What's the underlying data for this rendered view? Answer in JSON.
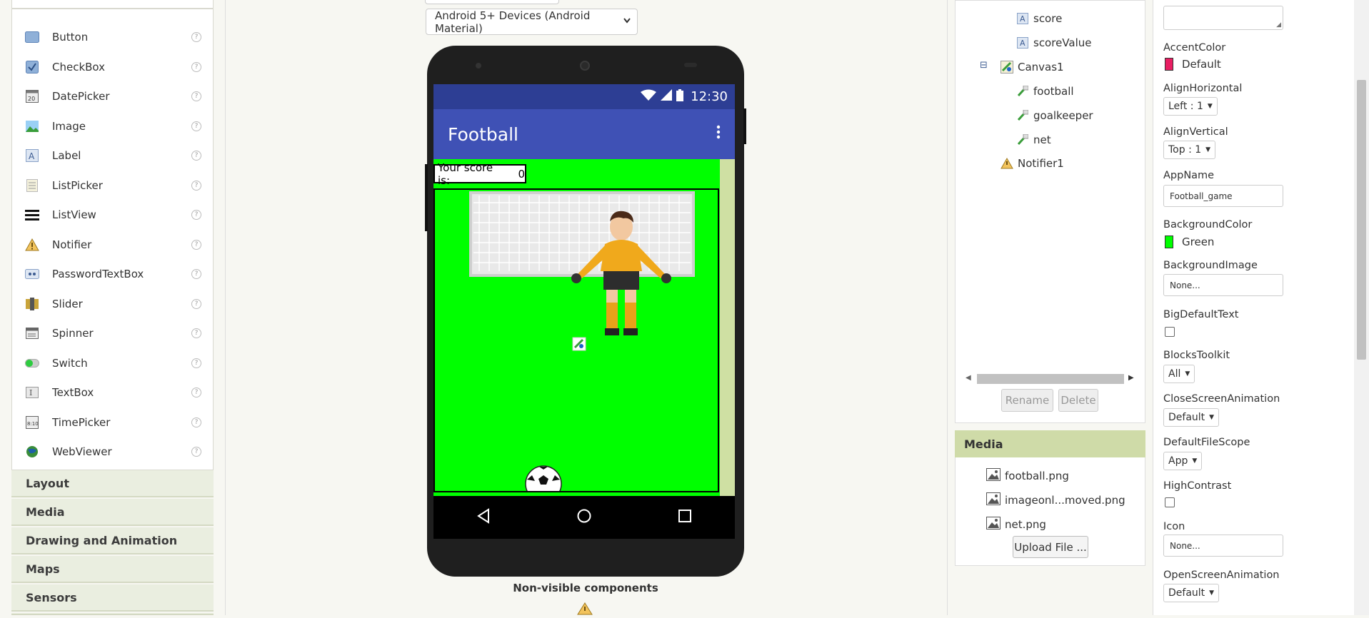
{
  "palette": {
    "items": [
      {
        "label": "Button",
        "icon": "button-icon"
      },
      {
        "label": "CheckBox",
        "icon": "checkbox-icon"
      },
      {
        "label": "DatePicker",
        "icon": "datepicker-icon"
      },
      {
        "label": "Image",
        "icon": "image-icon"
      },
      {
        "label": "Label",
        "icon": "label-icon"
      },
      {
        "label": "ListPicker",
        "icon": "listpicker-icon"
      },
      {
        "label": "ListView",
        "icon": "listview-icon"
      },
      {
        "label": "Notifier",
        "icon": "notifier-icon"
      },
      {
        "label": "PasswordTextBox",
        "icon": "passwordtextbox-icon"
      },
      {
        "label": "Slider",
        "icon": "slider-icon"
      },
      {
        "label": "Spinner",
        "icon": "spinner-icon"
      },
      {
        "label": "Switch",
        "icon": "switch-icon"
      },
      {
        "label": "TextBox",
        "icon": "textbox-icon"
      },
      {
        "label": "TimePicker",
        "icon": "timepicker-icon"
      },
      {
        "label": "WebViewer",
        "icon": "webviewer-icon"
      }
    ],
    "help_glyph": "?",
    "categories": [
      "Layout",
      "Media",
      "Drawing and Animation",
      "Maps",
      "Sensors"
    ]
  },
  "viewer": {
    "device_select": "Android 5+ Devices (Android Material)",
    "status_time": "12:30",
    "app_title": "Football",
    "score_label": "Your score is:",
    "score_value": "0",
    "nonvisible_title": "Non-visible components"
  },
  "tree": {
    "items": [
      {
        "label": "score",
        "icon": "label-icon"
      },
      {
        "label": "scoreValue",
        "icon": "label-icon"
      },
      {
        "label": "Canvas1",
        "icon": "canvas-icon"
      },
      {
        "label": "football",
        "icon": "imagesprite-icon"
      },
      {
        "label": "goalkeeper",
        "icon": "imagesprite-icon"
      },
      {
        "label": "net",
        "icon": "imagesprite-icon"
      },
      {
        "label": "Notifier1",
        "icon": "notifier-icon"
      }
    ],
    "collapse_glyph": "⊟",
    "rename_label": "Rename",
    "delete_label": "Delete"
  },
  "media": {
    "title": "Media",
    "files": [
      "football.png",
      "imageonl...moved.png",
      "net.png"
    ],
    "upload_label": "Upload File ..."
  },
  "properties": {
    "accent_color_label": "AccentColor",
    "accent_color_value": "Default",
    "accent_color_hex": "#e91e63",
    "align_h_label": "AlignHorizontal",
    "align_h_value": "Left : 1",
    "align_v_label": "AlignVertical",
    "align_v_value": "Top : 1",
    "appname_label": "AppName",
    "appname_value": "Football_game",
    "bgcolor_label": "BackgroundColor",
    "bgcolor_value": "Green",
    "bgcolor_hex": "#00ff00",
    "bgimage_label": "BackgroundImage",
    "bgimage_value": "None...",
    "bigdefault_label": "BigDefaultText",
    "blockstoolkit_label": "BlocksToolkit",
    "blockstoolkit_value": "All",
    "closeanim_label": "CloseScreenAnimation",
    "closeanim_value": "Default",
    "filescope_label": "DefaultFileScope",
    "filescope_value": "App",
    "highcontrast_label": "HighContrast",
    "icon_label": "Icon",
    "icon_value": "None...",
    "openanim_label": "OpenScreenAnimation",
    "openanim_value": "Default"
  },
  "colors": {
    "toolbar_blue": "#3f51b5",
    "status_blue": "#2d3e94",
    "screen_green": "#00ff00",
    "media_header": "#cfdba8"
  }
}
